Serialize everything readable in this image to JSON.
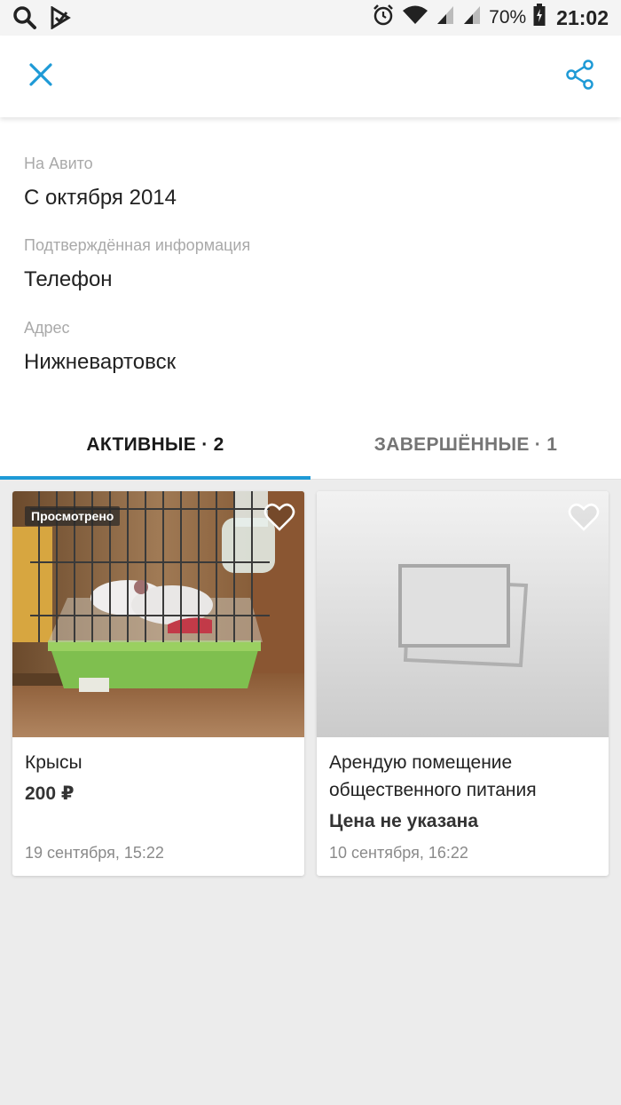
{
  "status_bar": {
    "battery": "70%",
    "time": "21:02"
  },
  "profile": {
    "on_avito_label": "На Авито",
    "on_avito_value": "С октября 2014",
    "verified_label": "Подтверждённая информация",
    "verified_value": "Телефон",
    "address_label": "Адрес",
    "address_value": "Нижневартовск"
  },
  "tabs": [
    {
      "label": "АКТИВНЫЕ · 2",
      "active": true
    },
    {
      "label": "ЗАВЕРШЁННЫЕ · 1",
      "active": false
    }
  ],
  "listings": [
    {
      "badge": "Просмотрено",
      "title": "Крысы",
      "price": "200 ₽",
      "date": "19 сентября, 15:22"
    },
    {
      "title": "Арендую помещение общественного питания",
      "price": "Цена не указана",
      "date": "10 сентября, 16:22"
    }
  ],
  "colors": {
    "accent": "#1e9ad6",
    "background": "#ececec"
  },
  "icons": [
    "search-icon",
    "play-store-icon",
    "alarm-icon",
    "wifi-icon",
    "signal-icon",
    "battery-icon",
    "close-icon",
    "share-icon",
    "heart-icon",
    "image-placeholder-icon"
  ]
}
